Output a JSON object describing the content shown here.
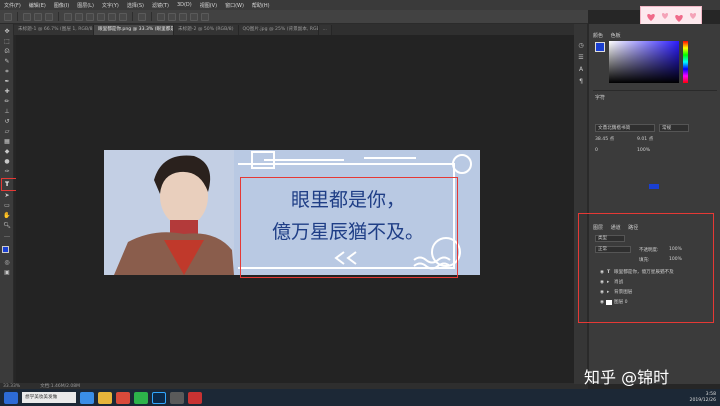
{
  "menubar": {
    "items": [
      "文件(F)",
      "编辑(E)",
      "图像(I)",
      "图层(L)",
      "文字(Y)",
      "选择(S)",
      "滤镜(T)",
      "3D(D)",
      "视图(V)",
      "窗口(W)",
      "帮助(H)"
    ]
  },
  "document_tabs": [
    {
      "label": "未标题-1 @ 66.7% (图层 1, RGB/8)",
      "active": false
    },
    {
      "label": "眼里都是你.png @ 33.3% (眼里都是你，憶万星辰猶不及, RGB/8)",
      "active": true
    },
    {
      "label": "未标题-2 @ 50% (RGB/8)",
      "active": false
    },
    {
      "label": "QQ图片.jpg @ 25% (背景副本, RGB/8)",
      "active": false
    },
    {
      "label": "...",
      "active": false
    }
  ],
  "canvas": {
    "line1": "眼里都是你，",
    "line2": "億万星辰猶不及。",
    "text_color": "#1f3e86",
    "bg_color": "#b9c9e3"
  },
  "statusbar": {
    "zoom": "33.33%",
    "doc": "文档:1.46M/2.08M"
  },
  "color_panel": {
    "tab1": "颜色",
    "tab2": "色板"
  },
  "char_panel": {
    "title": "字符",
    "font": "文鼎北魏楷书简",
    "style": "常规",
    "size": "38.45 点",
    "leading": "9.01 点",
    "tracking": "0",
    "scale": "100%"
  },
  "layers_panel": {
    "tabs": [
      "图层",
      "通道",
      "路径"
    ],
    "kind": "类型",
    "blend": "正常",
    "opacity_label": "不透明度:",
    "opacity": "100%",
    "fill_label": "填充:",
    "fill": "100%",
    "layers": [
      {
        "name": "眼里都是你，億万星辰猶不及",
        "type": "text"
      },
      {
        "name": "肖战",
        "type": "folder"
      },
      {
        "name": "背景图层",
        "type": "folder"
      },
      {
        "name": "图层 0",
        "type": "layer"
      }
    ]
  },
  "watermark": "知乎 @锦时",
  "taskbar": {
    "search_text": "想学美妆美发做",
    "clock_time": "3:58",
    "clock_date": "2019/12/26"
  },
  "accent": "#e53935"
}
